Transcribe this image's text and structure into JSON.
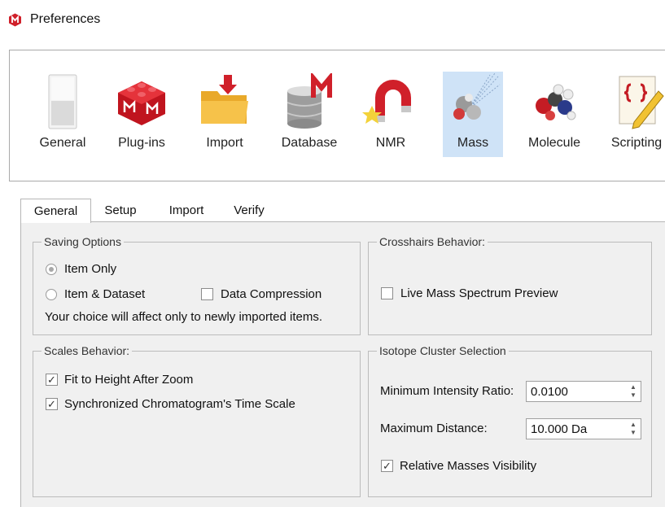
{
  "window": {
    "title": "Preferences"
  },
  "categories": [
    {
      "id": "general",
      "label": "General",
      "icon": "toggle-switch-icon"
    },
    {
      "id": "plugins",
      "label": "Plug-ins",
      "icon": "plugin-brick-icon"
    },
    {
      "id": "import",
      "label": "Import",
      "icon": "folder-import-icon"
    },
    {
      "id": "database",
      "label": "Database",
      "icon": "database-icon"
    },
    {
      "id": "nmr",
      "label": "NMR",
      "icon": "magnet-icon"
    },
    {
      "id": "mass",
      "label": "Mass",
      "icon": "mass-spec-icon",
      "selected": true
    },
    {
      "id": "molecule",
      "label": "Molecule",
      "icon": "molecule-icon"
    },
    {
      "id": "scripting",
      "label": "Scripting",
      "icon": "script-scroll-icon"
    }
  ],
  "tabs": [
    {
      "label": "General",
      "active": true
    },
    {
      "label": "Setup"
    },
    {
      "label": "Import"
    },
    {
      "label": "Verify"
    }
  ],
  "saving": {
    "legend": "Saving Options",
    "item_only": "Item Only",
    "item_dataset": "Item & Dataset",
    "data_compression": "Data Compression",
    "note": "Your choice will affect only to newly imported  items."
  },
  "crosshairs": {
    "legend": "Crosshairs Behavior:",
    "live_preview": "Live Mass Spectrum Preview"
  },
  "scales": {
    "legend": "Scales Behavior:",
    "fit_height": "Fit to Height After Zoom",
    "sync_time": "Synchronized Chromatogram's Time Scale"
  },
  "isotope": {
    "legend": "Isotope Cluster Selection",
    "min_ratio_label": "Minimum Intensity Ratio:",
    "min_ratio_value": "0.0100",
    "max_distance_label": "Maximum Distance:",
    "max_distance_value": "10.000 Da",
    "relative_masses": "Relative Masses Visibility"
  },
  "colors": {
    "accent": "#cfe3f7",
    "panel": "#f0f0f0",
    "brand_red": "#d0202a"
  }
}
